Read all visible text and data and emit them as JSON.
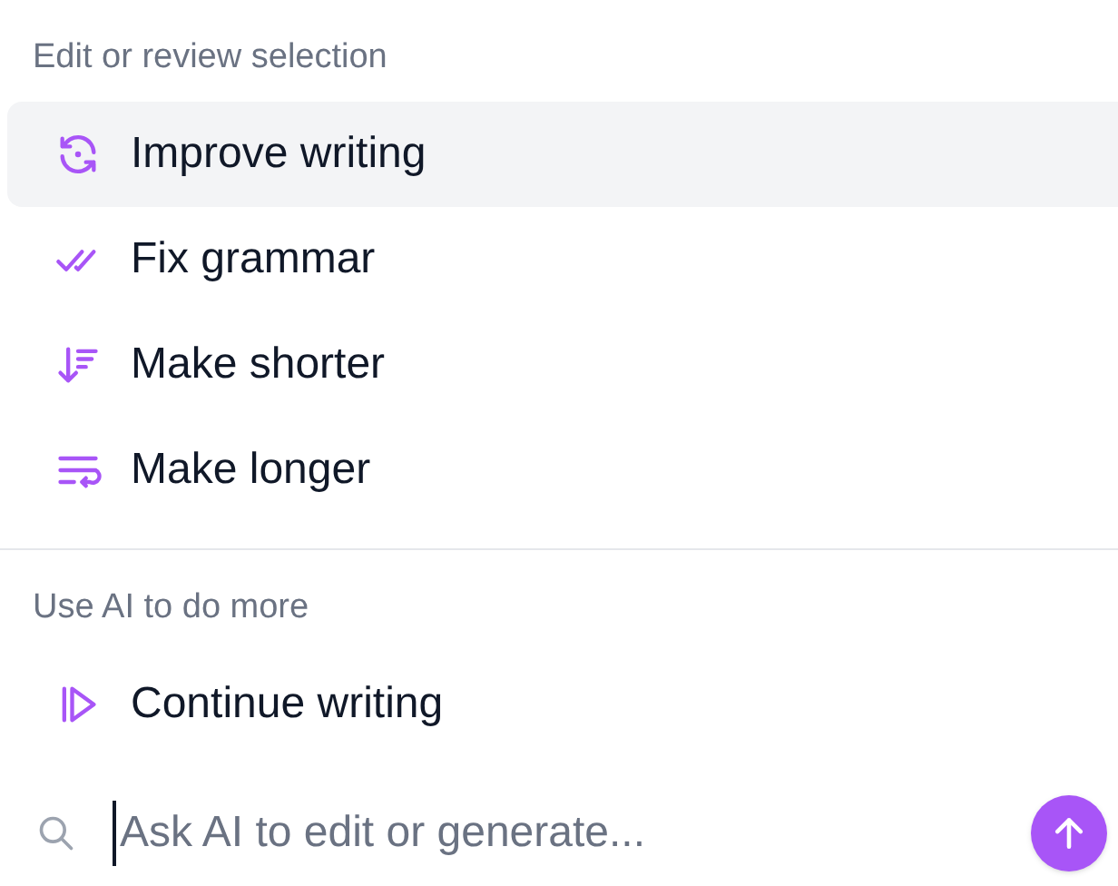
{
  "sections": [
    {
      "heading": "Edit or review selection",
      "items": [
        {
          "label": "Improve writing",
          "kind": "improve",
          "selected": true
        },
        {
          "label": "Fix grammar",
          "kind": "grammar",
          "selected": false
        },
        {
          "label": "Make shorter",
          "kind": "shorter",
          "selected": false
        },
        {
          "label": "Make longer",
          "kind": "longer",
          "selected": false
        }
      ]
    },
    {
      "heading": "Use AI to do more",
      "items": [
        {
          "label": "Continue writing",
          "kind": "continue",
          "selected": false
        }
      ]
    }
  ],
  "prompt": {
    "placeholder": "Ask AI to edit or generate..."
  }
}
